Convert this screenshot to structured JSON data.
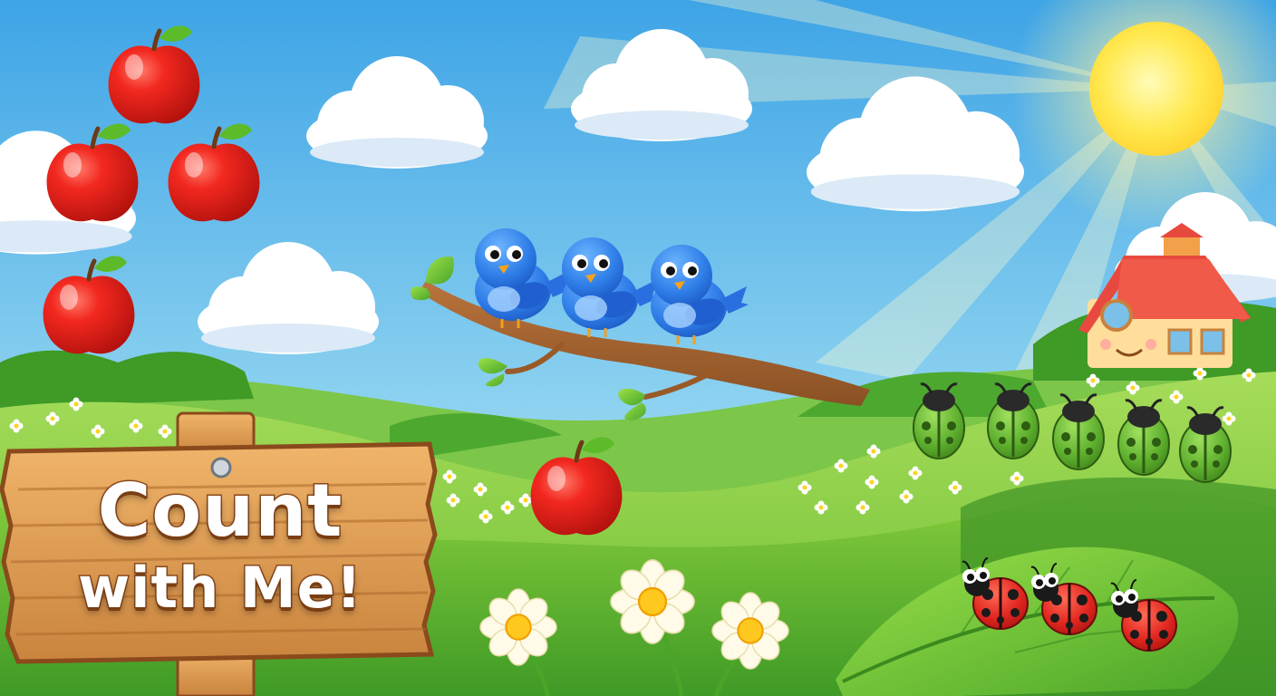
{
  "title": {
    "line1": "Count",
    "line2": "with Me!"
  },
  "counting_groups": [
    {
      "object": "apple",
      "count": 4
    },
    {
      "object": "bluebird",
      "count": 3
    },
    {
      "object": "apple",
      "count": 1
    },
    {
      "object": "green-beetle",
      "count": 5
    },
    {
      "object": "ladybug",
      "count": 3
    },
    {
      "object": "daisy",
      "count": 3
    }
  ],
  "colors": {
    "sky_top": "#3ea4e6",
    "sky_bottom": "#bfe9f5",
    "sun": "#ffe34a",
    "grass_light": "#8fd045",
    "grass_dark": "#3f9a26",
    "apple_red": "#e8231e",
    "bird_blue": "#2f7ee8",
    "beetle_green": "#5fb02f",
    "ladybug_red": "#e0261f",
    "wood": "#dfa05a",
    "house_roof": "#e8493f",
    "house_wall": "#ffdd9a"
  }
}
